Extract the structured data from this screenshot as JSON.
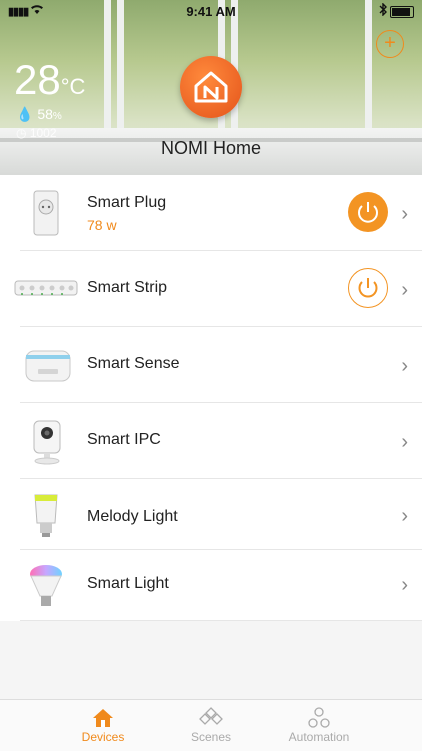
{
  "status_bar": {
    "time": "9:41 AM"
  },
  "weather": {
    "temperature": "28",
    "unit": "°C",
    "humidity": "58",
    "humidity_unit": "%",
    "pressure": "1002"
  },
  "header": {
    "home_name": "NOMI Home"
  },
  "devices": [
    {
      "name": "Smart Plug",
      "sub": "78 w",
      "power": "on"
    },
    {
      "name": "Smart Strip",
      "power": "off"
    },
    {
      "name": "Smart Sense"
    },
    {
      "name": "Smart IPC"
    },
    {
      "name": "Melody Light"
    },
    {
      "name": "Smart Light"
    }
  ],
  "tabs": [
    {
      "label": "Devices",
      "active": true
    },
    {
      "label": "Scenes"
    },
    {
      "label": "Automation"
    }
  ],
  "colors": {
    "accent": "#f08a1c",
    "accent_fill": "#f39423",
    "logo": "#e4531a"
  }
}
